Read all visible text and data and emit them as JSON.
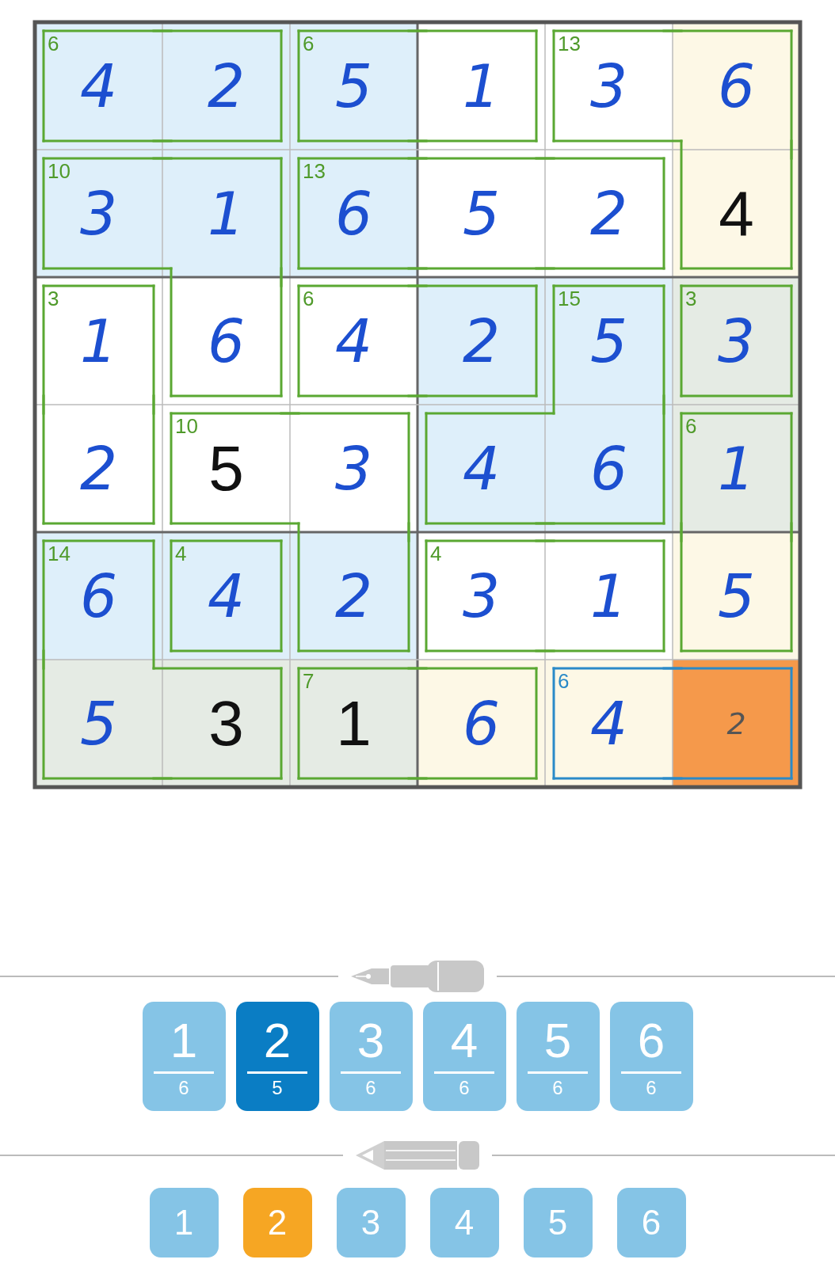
{
  "grid": {
    "rows": [
      [
        {
          "value": "4",
          "kind": "entered",
          "color": "#deeffa",
          "selected": false,
          "sum": "6",
          "cage_selected": false,
          "walls": {
            "top": true,
            "right": false,
            "bottom": true,
            "left": true
          }
        },
        {
          "value": "2",
          "kind": "entered",
          "color": "#deeffa",
          "selected": false,
          "cage_selected": false,
          "walls": {
            "top": true,
            "right": true,
            "bottom": true,
            "left": false
          }
        },
        {
          "value": "5",
          "kind": "entered",
          "color": "#deeffa",
          "selected": false,
          "sum": "6",
          "cage_selected": false,
          "walls": {
            "top": true,
            "right": false,
            "bottom": true,
            "left": true
          }
        },
        {
          "value": "1",
          "kind": "entered",
          "color": "#ffffff",
          "selected": false,
          "cage_selected": false,
          "walls": {
            "top": true,
            "right": true,
            "bottom": true,
            "left": false
          }
        },
        {
          "value": "3",
          "kind": "entered",
          "color": "#ffffff",
          "selected": false,
          "sum": "13",
          "cage_selected": false,
          "walls": {
            "top": true,
            "right": false,
            "bottom": true,
            "left": true
          }
        },
        {
          "value": "6",
          "kind": "entered",
          "color": "#fdf8e6",
          "selected": false,
          "cage_selected": false,
          "walls": {
            "top": true,
            "right": true,
            "bottom": false,
            "left": false
          }
        }
      ],
      [
        {
          "value": "3",
          "kind": "entered",
          "color": "#deeffa",
          "selected": false,
          "sum": "10",
          "cage_selected": false,
          "walls": {
            "top": true,
            "right": false,
            "bottom": true,
            "left": true
          }
        },
        {
          "value": "1",
          "kind": "entered",
          "color": "#deeffa",
          "selected": false,
          "cage_selected": false,
          "walls": {
            "top": true,
            "right": true,
            "bottom": false,
            "left": false
          }
        },
        {
          "value": "6",
          "kind": "entered",
          "color": "#deeffa",
          "selected": false,
          "sum": "13",
          "cage_selected": false,
          "walls": {
            "top": true,
            "right": false,
            "bottom": true,
            "left": true
          }
        },
        {
          "value": "5",
          "kind": "entered",
          "color": "#ffffff",
          "selected": false,
          "cage_selected": false,
          "walls": {
            "top": true,
            "right": false,
            "bottom": true,
            "left": false
          }
        },
        {
          "value": "2",
          "kind": "entered",
          "color": "#ffffff",
          "selected": false,
          "cage_selected": false,
          "walls": {
            "top": true,
            "right": true,
            "bottom": true,
            "left": false
          }
        },
        {
          "value": "4",
          "kind": "given",
          "color": "#fdf8e6",
          "selected": false,
          "cage_selected": false,
          "walls": {
            "top": false,
            "right": true,
            "bottom": true,
            "left": true
          }
        }
      ],
      [
        {
          "value": "1",
          "kind": "entered",
          "color": "#ffffff",
          "selected": false,
          "sum": "3",
          "cage_selected": false,
          "walls": {
            "top": true,
            "right": true,
            "bottom": false,
            "left": true
          }
        },
        {
          "value": "6",
          "kind": "entered",
          "color": "#ffffff",
          "selected": false,
          "cage_selected": false,
          "walls": {
            "top": false,
            "right": true,
            "bottom": true,
            "left": true
          }
        },
        {
          "value": "4",
          "kind": "entered",
          "color": "#ffffff",
          "selected": false,
          "sum": "6",
          "cage_selected": false,
          "walls": {
            "top": true,
            "right": false,
            "bottom": true,
            "left": true
          }
        },
        {
          "value": "2",
          "kind": "entered",
          "color": "#deeffa",
          "selected": false,
          "cage_selected": false,
          "walls": {
            "top": true,
            "right": true,
            "bottom": true,
            "left": false
          }
        },
        {
          "value": "5",
          "kind": "entered",
          "color": "#deeffa",
          "selected": false,
          "sum": "15",
          "cage_selected": false,
          "walls": {
            "top": true,
            "right": true,
            "bottom": false,
            "left": true
          }
        },
        {
          "value": "3",
          "kind": "entered",
          "color": "#e5ebe4",
          "selected": false,
          "sum": "3",
          "cage_selected": false,
          "walls": {
            "top": true,
            "right": true,
            "bottom": true,
            "left": true
          }
        }
      ],
      [
        {
          "value": "2",
          "kind": "entered",
          "color": "#ffffff",
          "selected": false,
          "cage_selected": false,
          "walls": {
            "top": false,
            "right": true,
            "bottom": true,
            "left": true
          }
        },
        {
          "value": "5",
          "kind": "given",
          "color": "#ffffff",
          "selected": false,
          "sum": "10",
          "cage_selected": false,
          "walls": {
            "top": true,
            "right": false,
            "bottom": true,
            "left": true
          }
        },
        {
          "value": "3",
          "kind": "entered",
          "color": "#ffffff",
          "selected": false,
          "cage_selected": false,
          "walls": {
            "top": true,
            "right": true,
            "bottom": false,
            "left": false
          }
        },
        {
          "value": "4",
          "kind": "entered",
          "color": "#deeffa",
          "selected": false,
          "cage_selected": false,
          "walls": {
            "top": true,
            "right": false,
            "bottom": true,
            "left": true
          }
        },
        {
          "value": "6",
          "kind": "entered",
          "color": "#deeffa",
          "selected": false,
          "cage_selected": false,
          "walls": {
            "top": false,
            "right": true,
            "bottom": true,
            "left": false
          }
        },
        {
          "value": "1",
          "kind": "entered",
          "color": "#e5ebe4",
          "selected": false,
          "sum": "6",
          "cage_selected": false,
          "walls": {
            "top": true,
            "right": true,
            "bottom": false,
            "left": true
          }
        }
      ],
      [
        {
          "value": "6",
          "kind": "entered",
          "color": "#deeffa",
          "selected": false,
          "sum": "14",
          "cage_selected": false,
          "walls": {
            "top": true,
            "right": true,
            "bottom": false,
            "left": true
          }
        },
        {
          "value": "4",
          "kind": "entered",
          "color": "#deeffa",
          "selected": false,
          "sum": "4",
          "cage_selected": false,
          "walls": {
            "top": true,
            "right": true,
            "bottom": true,
            "left": true
          }
        },
        {
          "value": "2",
          "kind": "entered",
          "color": "#deeffa",
          "selected": false,
          "cage_selected": false,
          "walls": {
            "top": false,
            "right": true,
            "bottom": true,
            "left": true
          }
        },
        {
          "value": "3",
          "kind": "entered",
          "color": "#ffffff",
          "selected": false,
          "sum": "4",
          "cage_selected": false,
          "walls": {
            "top": true,
            "right": false,
            "bottom": true,
            "left": true
          }
        },
        {
          "value": "1",
          "kind": "entered",
          "color": "#ffffff",
          "selected": false,
          "cage_selected": false,
          "walls": {
            "top": true,
            "right": true,
            "bottom": true,
            "left": false
          }
        },
        {
          "value": "5",
          "kind": "entered",
          "color": "#fdf8e6",
          "selected": false,
          "cage_selected": false,
          "walls": {
            "top": false,
            "right": true,
            "bottom": true,
            "left": true
          }
        }
      ],
      [
        {
          "value": "5",
          "kind": "entered",
          "color": "#e5ebe4",
          "selected": false,
          "cage_selected": false,
          "walls": {
            "top": false,
            "right": false,
            "bottom": true,
            "left": true
          }
        },
        {
          "value": "3",
          "kind": "given",
          "color": "#e5ebe4",
          "selected": false,
          "cage_selected": false,
          "walls": {
            "top": true,
            "right": true,
            "bottom": true,
            "left": false
          }
        },
        {
          "value": "1",
          "kind": "given",
          "color": "#e5ebe4",
          "selected": false,
          "sum": "7",
          "cage_selected": false,
          "walls": {
            "top": true,
            "right": false,
            "bottom": true,
            "left": true
          }
        },
        {
          "value": "6",
          "kind": "entered",
          "color": "#fdf8e6",
          "selected": false,
          "cage_selected": false,
          "walls": {
            "top": true,
            "right": true,
            "bottom": true,
            "left": false
          }
        },
        {
          "value": "4",
          "kind": "entered",
          "color": "#fdf8e6",
          "selected": false,
          "sum": "6",
          "cage_selected": true,
          "walls": {
            "top": true,
            "right": false,
            "bottom": true,
            "left": true
          }
        },
        {
          "value": "2",
          "kind": "note",
          "selected": true,
          "cage_selected": true,
          "walls": {
            "top": true,
            "right": true,
            "bottom": true,
            "left": false
          }
        }
      ]
    ]
  },
  "pen_pad": [
    {
      "digit": "1",
      "count": "6",
      "selected": false
    },
    {
      "digit": "2",
      "count": "5",
      "selected": true
    },
    {
      "digit": "3",
      "count": "6",
      "selected": false
    },
    {
      "digit": "4",
      "count": "6",
      "selected": false
    },
    {
      "digit": "5",
      "count": "6",
      "selected": false
    },
    {
      "digit": "6",
      "count": "6",
      "selected": false
    }
  ],
  "pencil_pad": [
    {
      "digit": "1",
      "selected": false
    },
    {
      "digit": "2",
      "selected": true
    },
    {
      "digit": "3",
      "selected": false
    },
    {
      "digit": "4",
      "selected": false
    },
    {
      "digit": "5",
      "selected": false
    },
    {
      "digit": "6",
      "selected": false
    }
  ]
}
